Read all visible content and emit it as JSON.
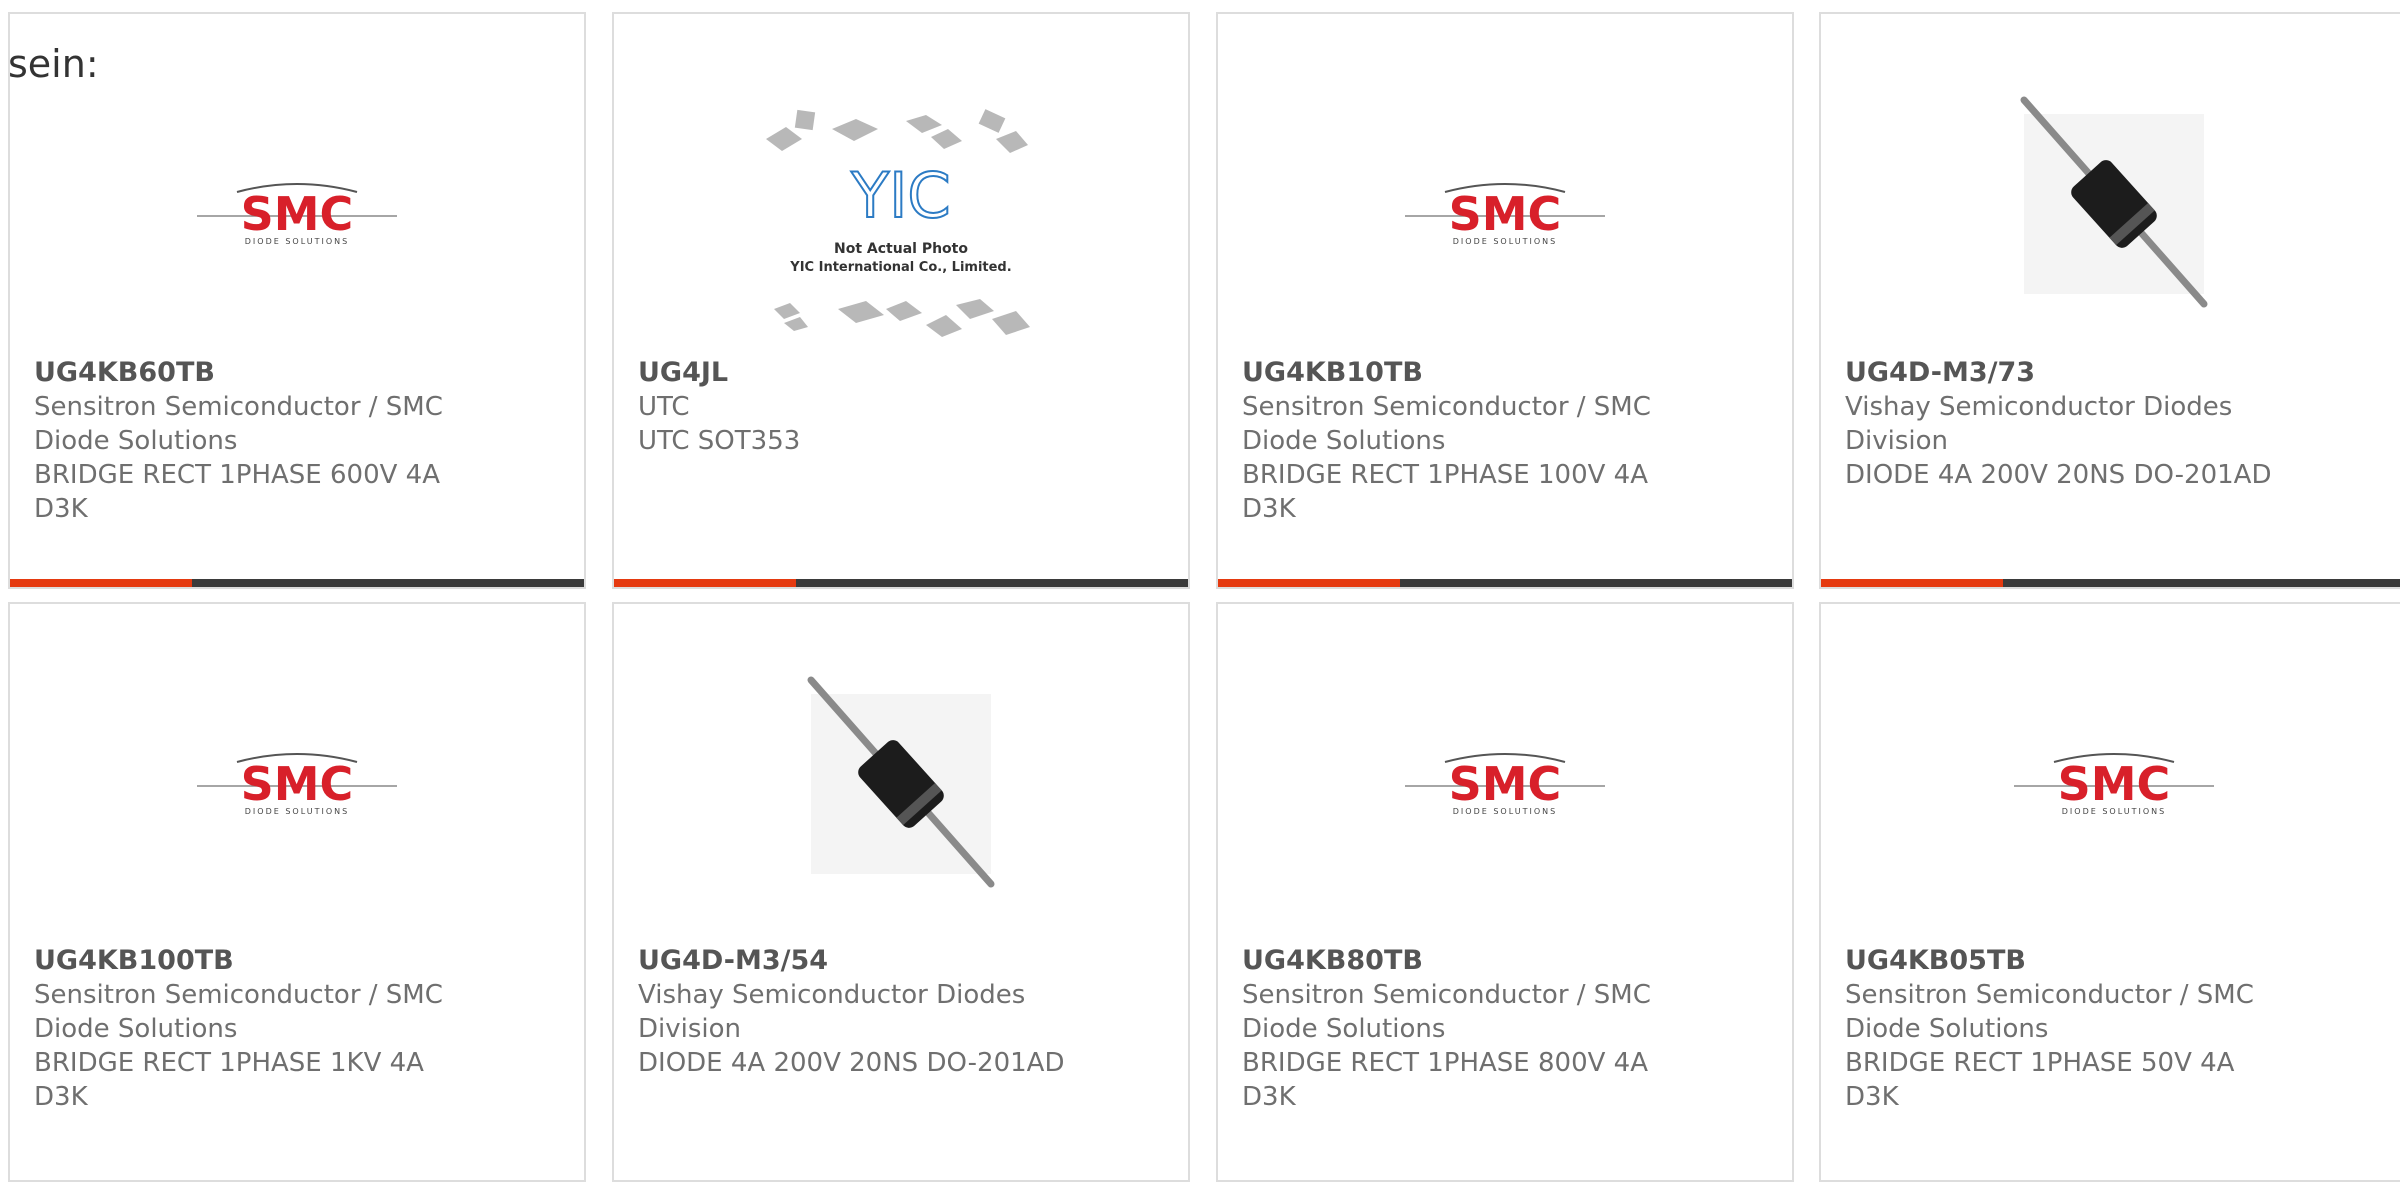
{
  "intro_text": "sein:",
  "colors": {
    "accent": "#e53a10",
    "bar": "#3b3b3b",
    "border": "#dddddd",
    "smc_red": "#d8202a"
  },
  "products": [
    {
      "part": "UG4KB60TB",
      "lines": [
        "Sensitron Semiconductor / SMC",
        "Diode Solutions",
        "BRIDGE RECT 1PHASE 600V 4A",
        "D3K"
      ],
      "image": "smc-logo"
    },
    {
      "part": "UG4JL",
      "lines": [
        "UTC",
        "UTC SOT353",
        "",
        ""
      ],
      "image": "yic-placeholder",
      "placeholder": {
        "logo": "YIC",
        "line1": "Not Actual Photo",
        "line2": "YIC International Co., Limited."
      }
    },
    {
      "part": "UG4KB10TB",
      "lines": [
        "Sensitron Semiconductor / SMC",
        "Diode Solutions",
        "BRIDGE RECT 1PHASE 100V 4A",
        "D3K"
      ],
      "image": "smc-logo"
    },
    {
      "part": "UG4D-M3/73",
      "lines": [
        "Vishay Semiconductor Diodes",
        "Division",
        "DIODE 4A 200V 20NS DO-201AD",
        ""
      ],
      "image": "diode-photo"
    },
    {
      "part": "UG4KB100TB",
      "lines": [
        "Sensitron Semiconductor / SMC",
        "Diode Solutions",
        "BRIDGE RECT 1PHASE 1KV 4A",
        "D3K"
      ],
      "image": "smc-logo"
    },
    {
      "part": "UG4D-M3/54",
      "lines": [
        "Vishay Semiconductor Diodes",
        "Division",
        "DIODE 4A 200V 20NS DO-201AD",
        ""
      ],
      "image": "diode-photo"
    },
    {
      "part": "UG4KB80TB",
      "lines": [
        "Sensitron Semiconductor / SMC",
        "Diode Solutions",
        "BRIDGE RECT 1PHASE 800V 4A",
        "D3K"
      ],
      "image": "smc-logo"
    },
    {
      "part": "UG4KB05TB",
      "lines": [
        "Sensitron Semiconductor / SMC",
        "Diode Solutions",
        "BRIDGE RECT 1PHASE 50V 4A",
        "D3K"
      ],
      "image": "smc-logo"
    }
  ]
}
